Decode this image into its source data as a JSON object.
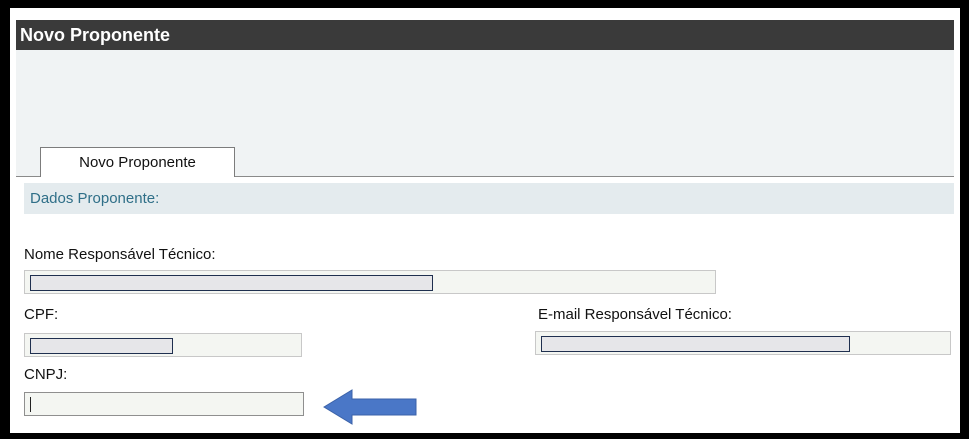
{
  "window": {
    "title": "Novo Proponente"
  },
  "tabs": [
    {
      "label": "Novo Proponente",
      "selected": true
    }
  ],
  "section": {
    "title": "Dados Proponente:"
  },
  "fields": {
    "nome_responsavel": {
      "label": "Nome Responsável Técnico:",
      "value": ""
    },
    "cpf": {
      "label": "CPF:",
      "value": ""
    },
    "email_responsavel": {
      "label": "E-mail Responsável Técnico:",
      "value": ""
    },
    "cnpj": {
      "label": "CNPJ:",
      "value": ""
    }
  },
  "colors": {
    "title_bar": "#3a3a3a",
    "section_header_bg": "#e4ebee",
    "section_header_text": "#2f6f88",
    "arrow": "#4a77c7"
  },
  "icons": {
    "pointer": "left-arrow-icon"
  }
}
